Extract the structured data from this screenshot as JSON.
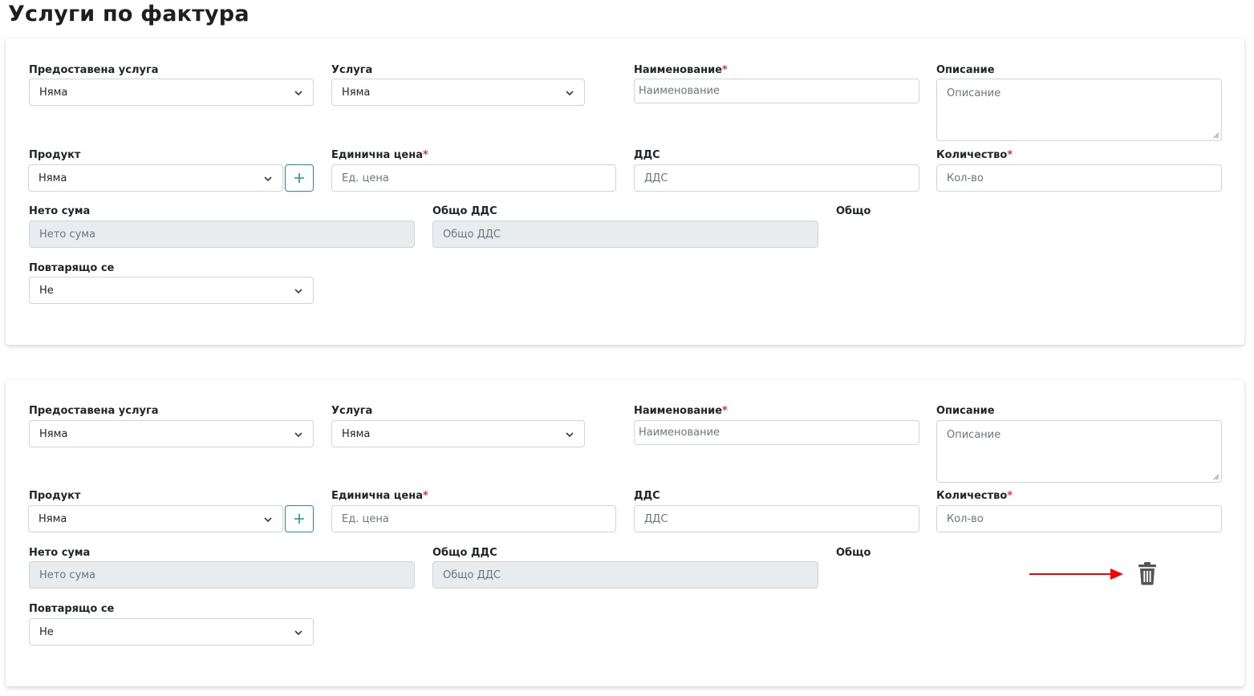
{
  "page": {
    "title": "Услуги по фактура"
  },
  "labels": {
    "provided_service": "Предоставена услуга",
    "service": "Услуга",
    "name": "Наименование",
    "description": "Описание",
    "product": "Продукт",
    "unit_price": "Единична цена",
    "vat": "ДДС",
    "quantity": "Количество",
    "net_amount": "Нето сума",
    "total_vat": "Общо ДДС",
    "total": "Общо",
    "recurring": "Повтарящо се",
    "required_mark": "*"
  },
  "items": [
    {
      "provided_service_value": "Няма",
      "service_value": "Няма",
      "name_placeholder": "Наименование",
      "description_placeholder": "Описание",
      "product_value": "Няма",
      "unit_price_placeholder": "Ед. цена",
      "vat_placeholder": "ДДС",
      "quantity_placeholder": "Кол-во",
      "net_amount_placeholder": "Нето сума",
      "total_vat_placeholder": "Общо ДДС",
      "recurring_value": "Не"
    },
    {
      "provided_service_value": "Няма",
      "service_value": "Няма",
      "name_placeholder": "Наименование",
      "description_placeholder": "Описание",
      "product_value": "Няма",
      "unit_price_placeholder": "Ед. цена",
      "vat_placeholder": "ДДС",
      "quantity_placeholder": "Кол-во",
      "net_amount_placeholder": "Нето сума",
      "total_vat_placeholder": "Общо ДДС",
      "recurring_value": "Не"
    }
  ],
  "icons": {
    "chevron": "chevron-down-icon",
    "add": "plus-icon",
    "delete": "trash-icon",
    "annotation": "red-arrow-icon"
  },
  "colors": {
    "accent": "#1a9b8a",
    "required": "#dc3545",
    "disabled_bg": "#e9ecef",
    "annotation_arrow": "#ff0000",
    "trash": "#555555"
  }
}
